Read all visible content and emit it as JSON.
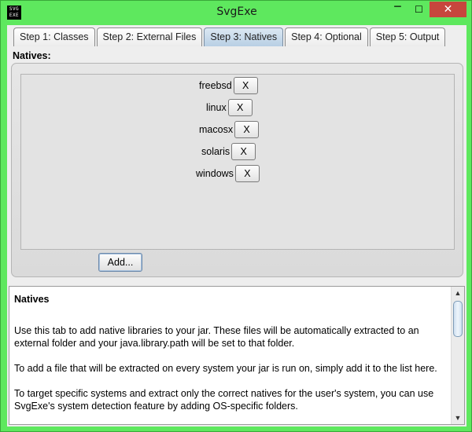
{
  "window": {
    "title": "SvgExe",
    "icon": {
      "name": "svgexe-app-icon",
      "line1": "SVG",
      "line2": "EXE"
    },
    "controls": {
      "minimize": "─",
      "maximize": "☐",
      "close": "✕"
    }
  },
  "tabs": [
    {
      "label": "Step 1: Classes",
      "active": false
    },
    {
      "label": "Step 2: External Files",
      "active": false
    },
    {
      "label": "Step 3: Natives",
      "active": true
    },
    {
      "label": "Step 4: Optional",
      "active": false
    },
    {
      "label": "Step 5: Output",
      "active": false
    }
  ],
  "natives": {
    "section_label": "Natives:",
    "remove_label": "X",
    "items": [
      {
        "name": "freebsd"
      },
      {
        "name": "linux"
      },
      {
        "name": "macosx"
      },
      {
        "name": "solaris"
      },
      {
        "name": "windows"
      }
    ],
    "add_label": "Add..."
  },
  "help": {
    "title": "Natives",
    "paragraphs": [
      "Use this tab to add native libraries to your jar. These files will be automatically extracted to an external folder and your java.library.path will be set to that folder.",
      "To add a file that will be extracted on every system your jar is run on, simply add it to the list here.",
      "To target specific systems and extract only the correct natives for the user's system, you can use SvgExe's system detection feature by adding OS-specific folders."
    ],
    "scroll_up": "▲",
    "scroll_down": "▼"
  },
  "colors": {
    "title_bar": "#5ee85e",
    "close_button": "#c7463d",
    "active_tab": "#b8cfe4",
    "client_bg": "#eeeeee"
  }
}
